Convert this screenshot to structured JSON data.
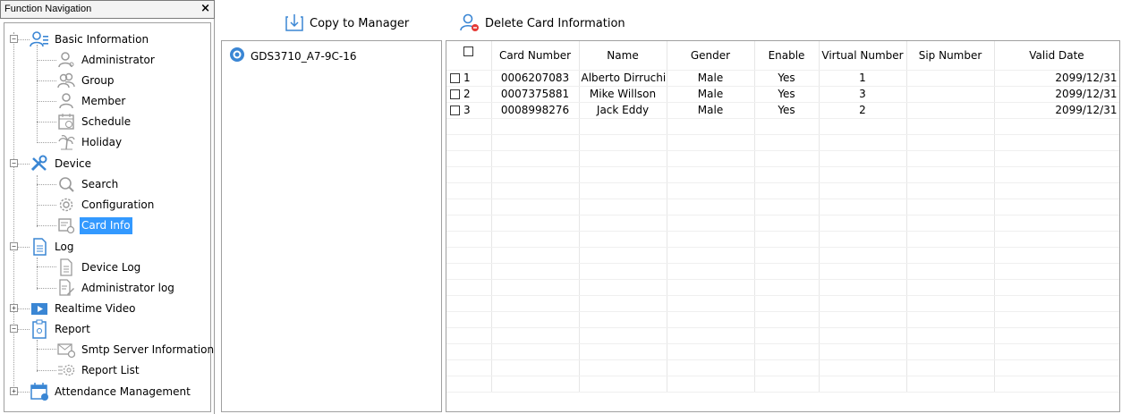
{
  "nav": {
    "title": "Function Navigation",
    "close": "×",
    "items": [
      {
        "label": "Basic Information"
      },
      {
        "label": "Administrator"
      },
      {
        "label": "Group"
      },
      {
        "label": "Member"
      },
      {
        "label": "Schedule"
      },
      {
        "label": "Holiday"
      },
      {
        "label": "Device"
      },
      {
        "label": "Search"
      },
      {
        "label": "Configuration"
      },
      {
        "label": "Card Info"
      },
      {
        "label": "Log"
      },
      {
        "label": "Device Log"
      },
      {
        "label": "Administrator log"
      },
      {
        "label": "Realtime Video"
      },
      {
        "label": "Report"
      },
      {
        "label": "Smtp Server Information"
      },
      {
        "label": "Report List"
      },
      {
        "label": "Attendance Management"
      }
    ]
  },
  "toolbar": {
    "copy_label": "Copy to Manager",
    "delete_label": "Delete Card Information"
  },
  "device": {
    "name": "GDS3710_A7-9C-16"
  },
  "grid": {
    "columns": [
      "Card Number",
      "Name",
      "Gender",
      "Enable",
      "Virtual Number",
      "Sip Number",
      "Valid Date"
    ],
    "rows": [
      {
        "num": "1",
        "card": "0006207083",
        "name": "Alberto Dirruchi",
        "gender": "Male",
        "enable": "Yes",
        "virtual": "1",
        "sip": "",
        "valid": "2099/12/31"
      },
      {
        "num": "2",
        "card": "0007375881",
        "name": "Mike Willson",
        "gender": "Male",
        "enable": "Yes",
        "virtual": "3",
        "sip": "",
        "valid": "2099/12/31"
      },
      {
        "num": "3",
        "card": "0008998276",
        "name": "Jack Eddy",
        "gender": "Male",
        "enable": "Yes",
        "virtual": "2",
        "sip": "",
        "valid": "2099/12/31"
      }
    ]
  },
  "colors": {
    "selection": "#3399ff",
    "icon_blue": "#3a86d4",
    "icon_gray": "#9a9a9a"
  }
}
